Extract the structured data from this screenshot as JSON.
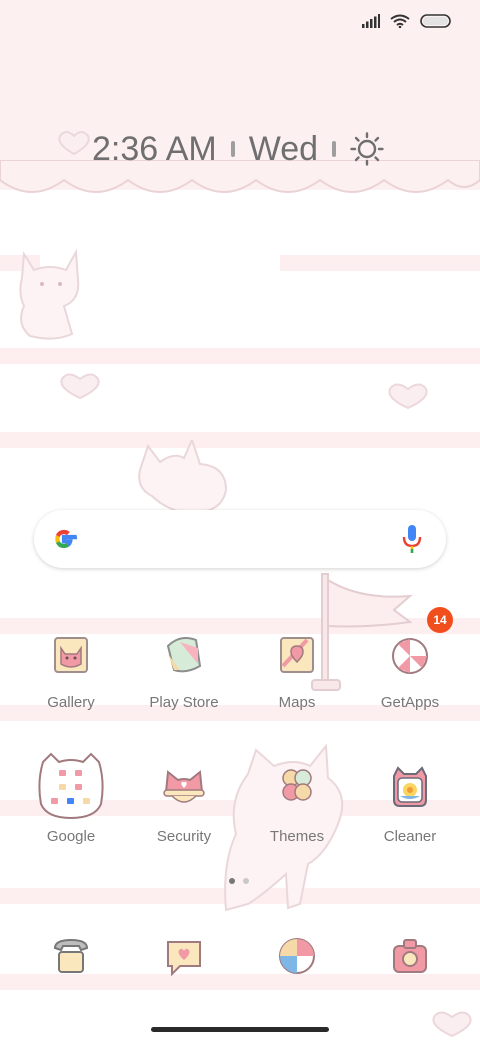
{
  "status_bar": {
    "signal_icon": "cellular-signal-icon",
    "wifi_icon": "wifi-icon",
    "battery_icon": "battery-icon"
  },
  "clock_widget": {
    "time": "2:36 AM",
    "day": "Wed",
    "weather_icon": "sun-icon"
  },
  "search_bar": {
    "logo_icon": "google-g-icon",
    "mic_icon": "microphone-icon"
  },
  "apps_row1": [
    {
      "label": "Gallery",
      "icon": "gallery-icon"
    },
    {
      "label": "Play Store",
      "icon": "play-store-icon"
    },
    {
      "label": "Maps",
      "icon": "maps-icon"
    },
    {
      "label": "GetApps",
      "icon": "getapps-icon",
      "badge": "14"
    }
  ],
  "apps_row2": [
    {
      "label": "Google",
      "icon": "google-folder-icon"
    },
    {
      "label": "Security",
      "icon": "security-icon"
    },
    {
      "label": "Themes",
      "icon": "themes-icon"
    },
    {
      "label": "Cleaner",
      "icon": "cleaner-icon"
    }
  ],
  "page_indicator": {
    "pages": 2,
    "current": 1
  },
  "dock": [
    {
      "icon": "phone-icon"
    },
    {
      "icon": "messages-icon"
    },
    {
      "icon": "browser-icon"
    },
    {
      "icon": "camera-icon"
    }
  ],
  "colors": {
    "stripe": "#fdeef0",
    "label": "#777777",
    "badge": "#f04e1c"
  }
}
